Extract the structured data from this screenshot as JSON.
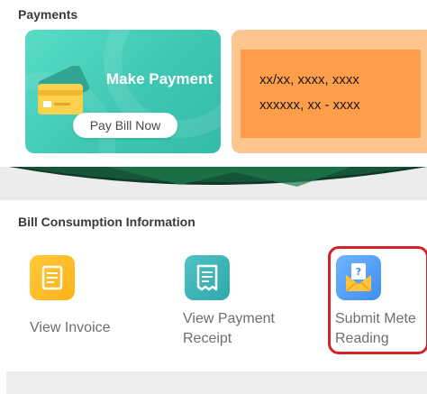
{
  "payments": {
    "title": "Payments",
    "make_payment_card": {
      "title": "Make Payment",
      "button_label": "Pay Bill Now",
      "icon": "credit-card-icon"
    },
    "info_card": {
      "line1": "xx/xx, xxxx, xxxx",
      "line2": "xxxxxx, xx - xxxx"
    }
  },
  "bill_consumption": {
    "title": "Bill Consumption Information",
    "tiles": [
      {
        "label": [
          "View Invoice"
        ],
        "icon": "invoice-icon",
        "color": "#ffb81f"
      },
      {
        "label": [
          "View Payment",
          "Receipt"
        ],
        "icon": "receipt-icon",
        "color": "#34adb1"
      },
      {
        "label": [
          "Submit Mete",
          "Reading"
        ],
        "icon": "meter-reading-icon",
        "color": "#4794f2"
      }
    ]
  },
  "colors": {
    "highlight": "#d42027",
    "payment_card": "#45cdb8",
    "info_card": "#ff9e4a"
  }
}
